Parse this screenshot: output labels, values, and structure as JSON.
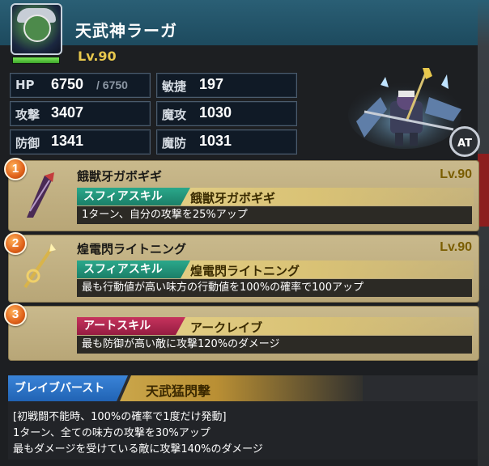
{
  "unit": {
    "name": "天武神ラーガ",
    "level": "Lv.90",
    "hp_fill": 1.0
  },
  "stats": {
    "hp": {
      "label": "HP",
      "value": "6750",
      "max": "/ 6750"
    },
    "agi": {
      "label": "敏捷",
      "value": "197"
    },
    "atk": {
      "label": "攻撃",
      "value": "3407"
    },
    "matk": {
      "label": "魔攻",
      "value": "1030"
    },
    "def": {
      "label": "防御",
      "value": "1341"
    },
    "mdef": {
      "label": "魔防",
      "value": "1031"
    }
  },
  "at_badge": "AT",
  "skills": [
    {
      "num": "1",
      "title": "餓獣牙ガボギギ",
      "level": "Lv.90",
      "tag": "スフィアスキル",
      "tag_name": "餓獣牙ガボギギ",
      "desc": "1ターン、自分の攻撃を25%アップ",
      "tag_color": "#1b7f68"
    },
    {
      "num": "2",
      "title": "煌電閃ライトニング",
      "level": "Lv.90",
      "tag": "スフィアスキル",
      "tag_name": "煌電閃ライトニング",
      "desc": "最も行動値が高い味方の行動値を100%の確率で100アップ",
      "tag_color": "#1b7f68"
    },
    {
      "num": "3",
      "tag": "アートスキル",
      "tag_name": "アークレイブ",
      "desc": "最も防御が高い敵に攻撃120%のダメージ",
      "tag_color": "#951c41"
    }
  ],
  "brave_burst": {
    "label": "ブレイブバースト",
    "name": "天武猛閃撃",
    "lines": [
      "[初戦闘不能時、100%の確率で1度だけ発動]",
      "1ターン、全ての味方の攻撃を30%アップ",
      "最もダメージを受けている敵に攻撃140%のダメージ"
    ]
  }
}
